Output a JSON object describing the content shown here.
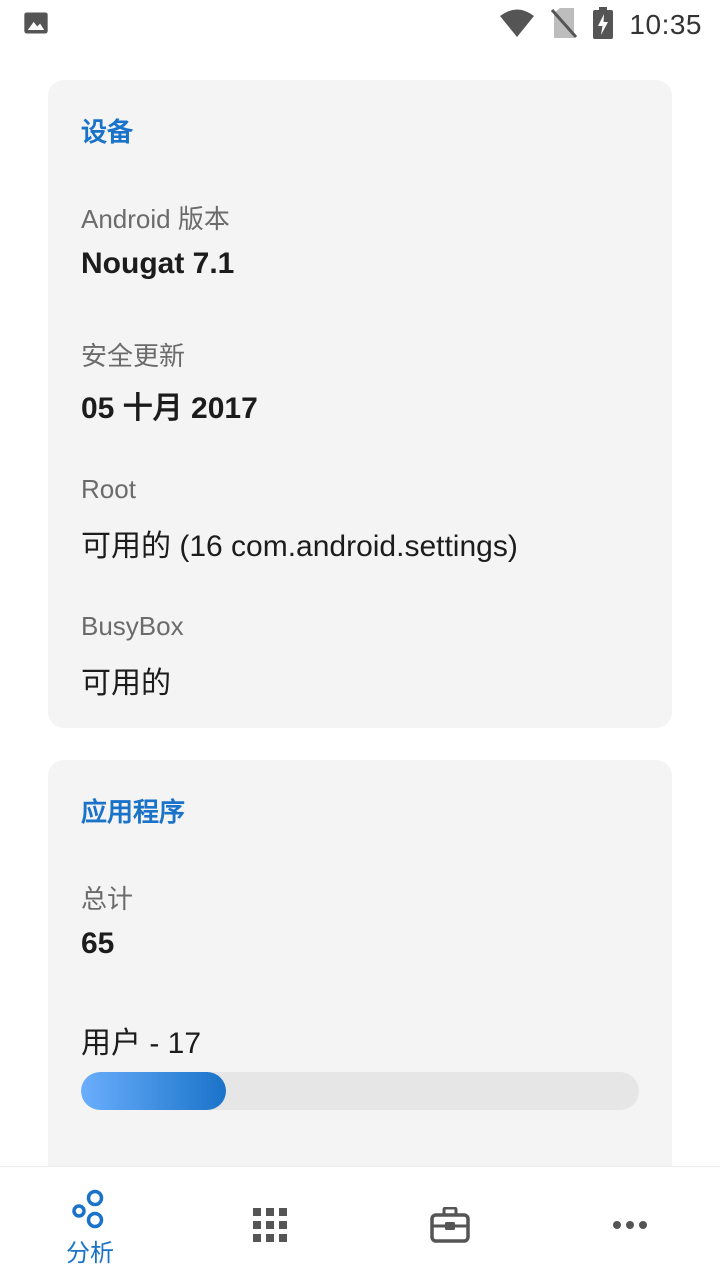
{
  "status_bar": {
    "time": "10:35",
    "icons": [
      "image-icon",
      "wifi-icon",
      "no-sim-icon",
      "battery-charging-icon"
    ]
  },
  "device_card": {
    "title": "设备",
    "fields": [
      {
        "label": "Android 版本",
        "value": "Nougat 7.1"
      },
      {
        "label": "安全更新",
        "value": "05 十月 2017"
      },
      {
        "label": "Root",
        "value": "可用的 (16 com.android.settings)"
      },
      {
        "label": "BusyBox",
        "value": "可用的"
      }
    ]
  },
  "apps_card": {
    "title": "应用程序",
    "total_label": "总计",
    "total_value": "65",
    "user_label": "用户 - 17",
    "user_progress_percent": 26
  },
  "bottom_nav": {
    "items": [
      {
        "icon": "analyze-icon",
        "label": "分析",
        "active": true
      },
      {
        "icon": "apps-grid-icon",
        "label": ""
      },
      {
        "icon": "toolbox-icon",
        "label": ""
      },
      {
        "icon": "more-icon",
        "label": ""
      }
    ]
  },
  "colors": {
    "accent": "#1a73c9",
    "card_bg": "#f4f4f4",
    "progress_start": "#6aaefc",
    "progress_end": "#1a73c9"
  }
}
